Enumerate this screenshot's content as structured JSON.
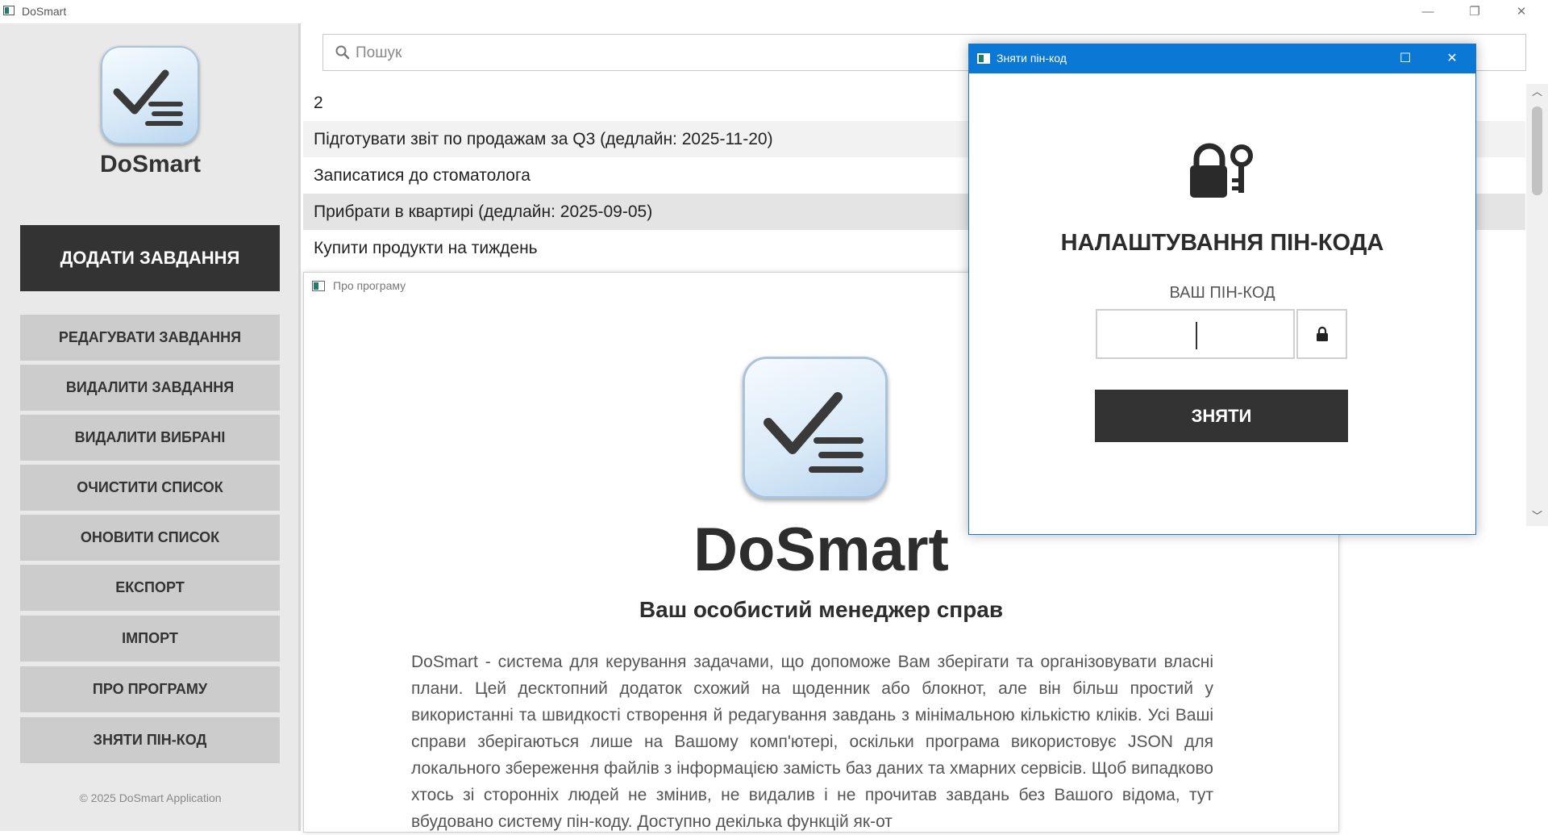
{
  "window": {
    "title": "DoSmart",
    "minimize": "—",
    "restore": "❐",
    "close": "✕"
  },
  "sidebar": {
    "app_name": "DoSmart",
    "add_button": "ДОДАТИ ЗАВДАННЯ",
    "buttons": [
      "РЕДАГУВАТИ ЗАВДАННЯ",
      "ВИДАЛИТИ ЗАВДАННЯ",
      "ВИДАЛИТИ ВИБРАНІ",
      "ОЧИСТИТИ СПИСОК",
      "ОНОВИТИ СПИСОК",
      "ЕКСПОРТ",
      "ІМПОРТ",
      "ПРО ПРОГРАМУ",
      "ЗНЯТИ ПІН-КОД"
    ],
    "copyright": "© 2025 DoSmart Application"
  },
  "search": {
    "placeholder": "Пошук",
    "icon": "search-icon"
  },
  "tasks": [
    "2",
    "Підготувати звіт по продажам за Q3 (дедлайн: 2025-11-20)",
    "Записатися до стоматолога",
    "Прибрати в квартирі (дедлайн: 2025-09-05)",
    "Купити продукти на тиждень"
  ],
  "about": {
    "window_title": "Про програму",
    "app_name": "DoSmart",
    "subtitle": "Ваш особистий менеджер справ",
    "description": "DoSmart - система для керування задачами, що допоможе Вам зберігати та організовувати власні плани. Цей десктопний додаток схожий на щоденник або блокнот, але він більш простий у використанні та швидкості створення й редагування завдань з мінімальною кількістю кліків. Усі Ваші справи зберігаються лише на Вашому комп'ютері, оскільки програма використовує JSON для локального збереження файлів з інформацією замість баз даних та хмарних сервісів. Щоб випадково хтось зі сторонніх людей не змінив, не видалив і не прочитав завдань без Вашого відома, тут вбудовано систему пін-коду. Доступно декілька функцій як-от"
  },
  "pin_dialog": {
    "title": "Зняти пін-код",
    "heading": "НАЛАШТУВАННЯ ПІН-КОДА",
    "field_label": "ВАШ ПІН-КОД",
    "pin_value": "",
    "submit": "ЗНЯТИ",
    "maximize": "☐",
    "close": "✕"
  },
  "colors": {
    "dark_button": "#333333",
    "side_button": "#cccccc",
    "sidebar_bg": "#e9e9e9",
    "dialog_titlebar": "#0a78d4"
  }
}
